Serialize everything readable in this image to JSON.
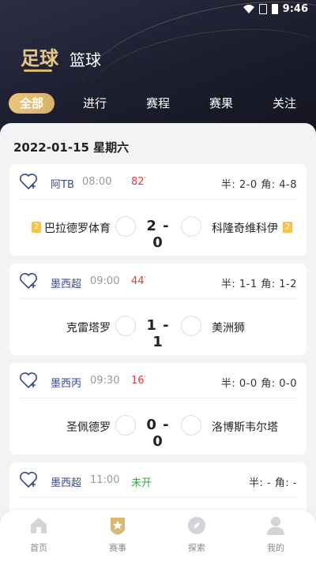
{
  "status_bar": {
    "time": "9:46"
  },
  "sport_tabs": [
    {
      "label": "足球",
      "active": true
    },
    {
      "label": "篮球",
      "active": false
    }
  ],
  "filter_tabs": [
    "全部",
    "进行",
    "赛程",
    "赛果",
    "关注"
  ],
  "date_header": "2022-01-15 星期六",
  "matches": [
    {
      "league": "阿TB",
      "time": "08:00",
      "minute": "82",
      "status": "",
      "half_corner": "半: 2-0 角: 4-8",
      "home": "巴拉德罗体育",
      "away": "科隆奇维科伊",
      "score": "2 - 0",
      "home_rank": "2",
      "away_rank": "2"
    },
    {
      "league": "墨西超",
      "time": "09:00",
      "minute": "44",
      "status": "",
      "half_corner": "半: 1-1 角: 1-2",
      "home": "克雷塔罗",
      "away": "美洲狮",
      "score": "1 - 1"
    },
    {
      "league": "墨西丙",
      "time": "09:30",
      "minute": "16",
      "status": "",
      "half_corner": "半: 0-0 角: 0-0",
      "home": "圣佩德罗",
      "away": "洛博斯韦尔塔",
      "score": "0 - 0"
    },
    {
      "league": "墨西超",
      "time": "11:00",
      "minute": "",
      "status": "未开",
      "half_corner": "半: - 角: -"
    }
  ],
  "bottom_nav": [
    {
      "label": "首页",
      "icon": "home-icon",
      "active": false
    },
    {
      "label": "赛事",
      "icon": "star-badge-icon",
      "active": true
    },
    {
      "label": "探索",
      "icon": "compass-icon",
      "active": false
    },
    {
      "label": "我的",
      "icon": "user-icon",
      "active": false
    }
  ],
  "colors": {
    "accent_gold": "#d9b774",
    "header_dark": "#1c1d2e",
    "live_red": "#e23b3b",
    "not_started_green": "#2eab3b",
    "league_blue": "#3b4a8c"
  }
}
